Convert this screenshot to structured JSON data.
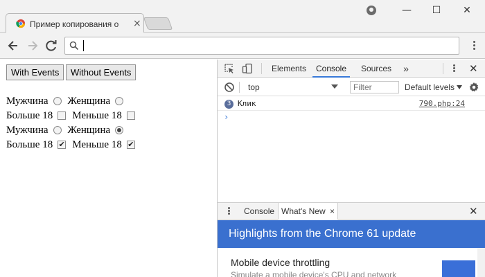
{
  "browser": {
    "tab": {
      "title": "Пример копирования о",
      "close_label": "×",
      "favicon": "chrome-favicon-icon"
    },
    "window_controls": {
      "minimize": "—",
      "maximize": "☐",
      "close": "✕"
    },
    "toolbar": {
      "back": "back-arrow-icon",
      "forward": "forward-arrow-icon",
      "reload": "reload-icon",
      "omnibox_value": "",
      "omnibox_icon": "search-icon"
    }
  },
  "page": {
    "buttons": {
      "with_events": "With Events",
      "without_events": "Without Events"
    },
    "rows": [
      {
        "a_label": "Мужчина",
        "a_checked": false,
        "b_label": "Женщина",
        "b_checked": false,
        "type": "radio"
      },
      {
        "a_label": "Больше 18",
        "a_checked": false,
        "b_label": "Меньше 18",
        "b_checked": false,
        "type": "checkbox"
      },
      {
        "a_label": "Мужчина",
        "a_checked": false,
        "b_label": "Женщина",
        "b_checked": true,
        "type": "radio"
      },
      {
        "a_label": "Больше 18",
        "a_checked": true,
        "b_label": "Меньше 18",
        "b_checked": true,
        "type": "checkbox"
      }
    ]
  },
  "devtools": {
    "tabs": {
      "elements": "Elements",
      "console": "Console",
      "sources": "Sources",
      "more": "»"
    },
    "active_tab": "Console",
    "context": "top",
    "filter_placeholder": "Filter",
    "levels": "Default levels",
    "log": {
      "count": "3",
      "message": "Клик",
      "source": "790.php:24"
    },
    "prompt": "›",
    "drawer": {
      "tabs": {
        "console": "Console",
        "whats_new": "What's New"
      },
      "active_tab": "What's New",
      "close": "×",
      "banner": "Highlights from the Chrome 61 update",
      "item_title": "Mobile device throttling",
      "item_desc": "Simulate a mobile device's CPU and network"
    },
    "accent_color": "#3879d9",
    "banner_color": "#3a70cf"
  }
}
